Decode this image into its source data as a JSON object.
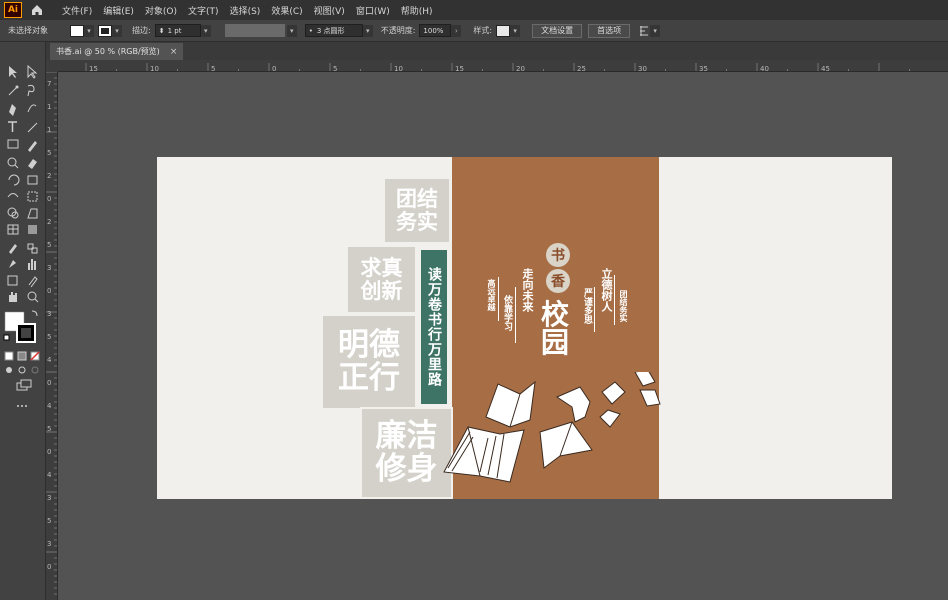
{
  "app": {
    "logo_text": "Ai",
    "menu": [
      "文件(F)",
      "编辑(E)",
      "对象(O)",
      "文字(T)",
      "选择(S)",
      "效果(C)",
      "视图(V)",
      "窗口(W)",
      "帮助(H)"
    ]
  },
  "control": {
    "no_selection": "未选择对象",
    "stroke_label": "描边:",
    "stroke_value": "1 pt",
    "brush_value": "3 点圆形",
    "opacity_label": "不透明度:",
    "opacity_value": "100%",
    "style_label": "样式:",
    "doc_setup": "文档设置",
    "prefs": "首选项"
  },
  "tab": {
    "title": "书香.ai @ 50 % (RGB/预览)",
    "close": "×"
  },
  "ruler": {
    "h_labels": [
      "15",
      "10",
      "5",
      "0",
      "5",
      "10",
      "15",
      "20",
      "25",
      "30",
      "35",
      "40",
      "45"
    ],
    "v_labels": [
      "7",
      "1",
      "1",
      "5",
      "2",
      "0",
      "2",
      "5",
      "3",
      "0",
      "3",
      "5",
      "4",
      "0",
      "4",
      "5",
      "0",
      "4",
      "3",
      "5",
      "3",
      "0"
    ]
  },
  "artboard": {
    "block1": [
      "团结",
      "务实"
    ],
    "block2": [
      "求真",
      "创新"
    ],
    "block3": [
      "明德",
      "正行"
    ],
    "block4": [
      "廉洁",
      "修身"
    ],
    "green_text": "读万卷书行万里路",
    "seal1": "书",
    "seal2": "香",
    "title_big": "校园",
    "cols": [
      "立德树人",
      "严谨多思",
      "团结务实",
      "走向未来",
      "依靠学习",
      "高远卓越"
    ]
  },
  "colors": {
    "brown": "#a76e46",
    "green": "#3d7466",
    "block": "#d3d1ca",
    "paper": "#f1f0ed"
  }
}
